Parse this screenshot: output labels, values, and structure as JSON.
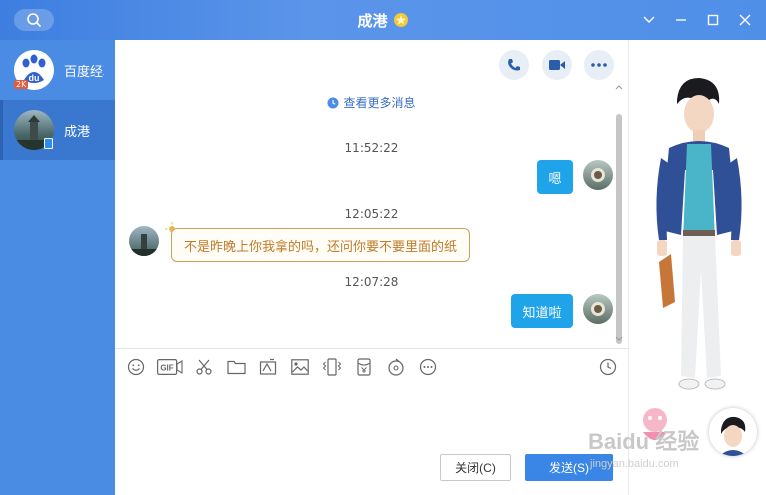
{
  "window": {
    "title": "成港"
  },
  "sidebar": {
    "items": [
      {
        "label": "百度经验",
        "badge": "2K"
      },
      {
        "label": "成港"
      }
    ]
  },
  "chat": {
    "more_messages": "查看更多消息",
    "messages": [
      {
        "time": "11:52:22",
        "text": "嗯",
        "direction": "out"
      },
      {
        "time": "12:05:22",
        "text": "不是昨晚上你我拿的吗，还问你要不要里面的纸",
        "direction": "in"
      },
      {
        "time": "12:07:28",
        "text": "知道啦",
        "direction": "out"
      }
    ]
  },
  "input": {
    "close_label": "关闭(C)",
    "send_label": "发送(S)"
  },
  "toolbar": {
    "gif_label": "GIF"
  },
  "watermark": {
    "main": "Baidu 经验",
    "sub": "jingyan.baidu.com"
  },
  "colors": {
    "accent": "#3a86e6",
    "bubble_out": "#1fa3e9",
    "bubble_in_text": "#c07a2a",
    "sidebar": "#4a8be3"
  }
}
